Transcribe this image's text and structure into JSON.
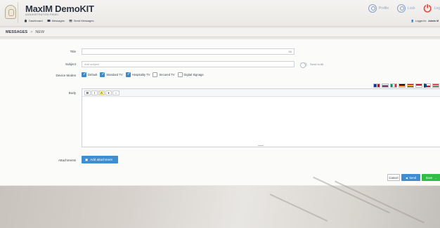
{
  "app": {
    "title": "MaxIM DemoKIT",
    "subtitle": "ADMINISTRATION PANEL"
  },
  "nav": [
    {
      "label": "Dashboard",
      "icon": "home-icon"
    },
    {
      "label": "Messages",
      "icon": "messages-icon"
    },
    {
      "label": "Send Messages",
      "icon": "list-icon"
    }
  ],
  "top_right": {
    "profile_label": "Profile",
    "lock_label": "Lock",
    "logout_label": "Log",
    "logged_in_prefix": "Logged in:",
    "logged_in_user": "Admin M"
  },
  "breadcrumb": {
    "section": "MESSAGES",
    "separator": ">",
    "current": "NEW"
  },
  "form": {
    "title_label": "Title",
    "title_counter": "50",
    "subject_label": "Subject",
    "subject_placeholder": "Add subject",
    "send_to_all_label": "Send to All",
    "device_modes_label": "Device Modes",
    "modes": [
      {
        "label": "Default",
        "checked": true
      },
      {
        "label": "Standard TV",
        "checked": true
      },
      {
        "label": "Hospitality TV",
        "checked": true
      },
      {
        "label": "Secured TV",
        "checked": false
      },
      {
        "label": "Digital Signage",
        "checked": false
      }
    ],
    "body_label": "Body",
    "toolbar": [
      "B",
      "I",
      "A",
      "▾",
      "⇔"
    ],
    "attachments_label": "Attachments",
    "add_attachment_label": "Add attachment"
  },
  "actions": {
    "cancel_label": "Cancel",
    "send_label": "Send",
    "save_label": "Save"
  },
  "colors": {
    "primary": "#3f8ed1",
    "success": "#2fbf46",
    "danger": "#e2483d"
  }
}
